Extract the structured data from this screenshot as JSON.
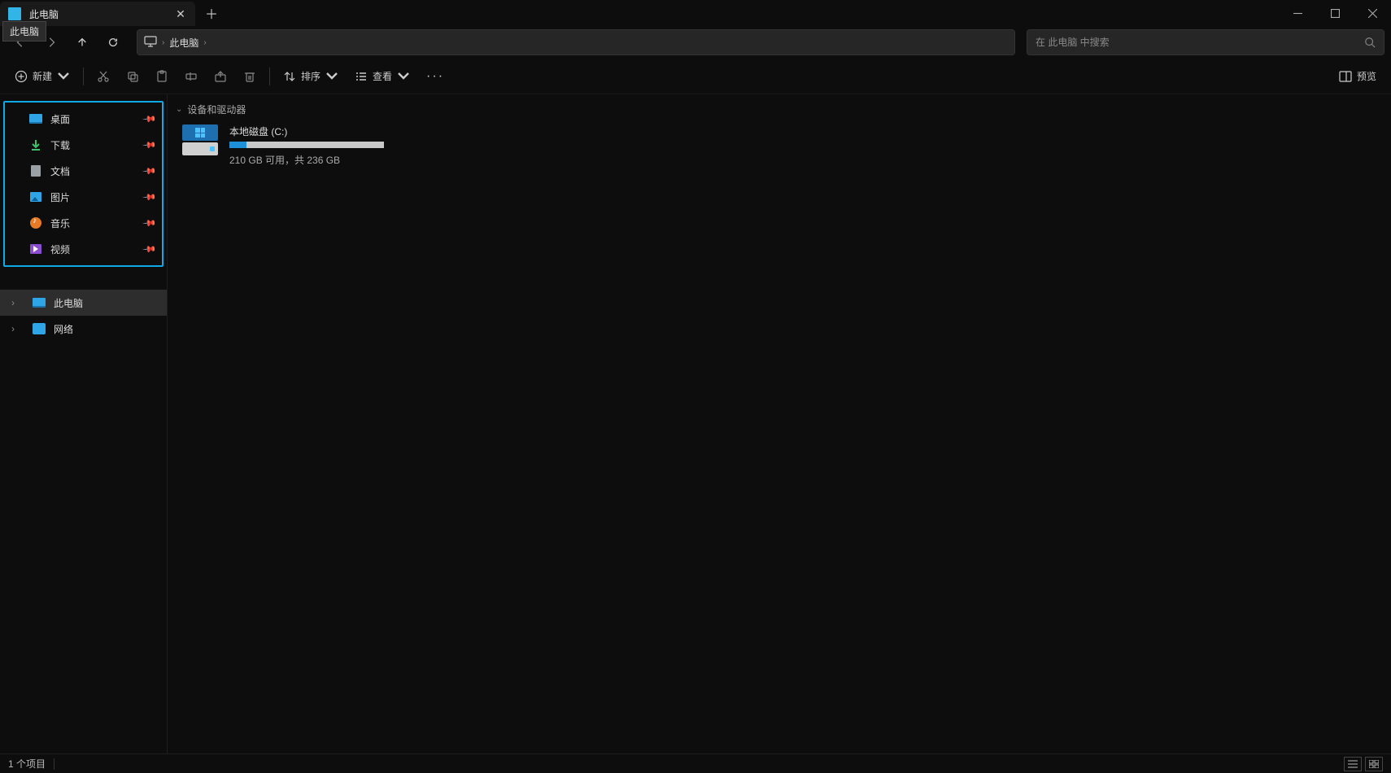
{
  "tab": {
    "title": "此电脑"
  },
  "tooltip": "此电脑",
  "breadcrumb": {
    "location": "此电脑"
  },
  "search": {
    "placeholder": "在 此电脑 中搜索"
  },
  "toolbar": {
    "new_label": "新建",
    "sort_label": "排序",
    "view_label": "查看",
    "preview_label": "预览"
  },
  "sidebar": {
    "quick": [
      {
        "label": "桌面"
      },
      {
        "label": "下载"
      },
      {
        "label": "文档"
      },
      {
        "label": "图片"
      },
      {
        "label": "音乐"
      },
      {
        "label": "视频"
      }
    ],
    "tree": [
      {
        "label": "此电脑",
        "selected": true
      },
      {
        "label": "网络",
        "selected": false
      }
    ]
  },
  "content": {
    "group_header": "设备和驱动器",
    "drive": {
      "name": "本地磁盘 (C:)",
      "capacity": "210 GB 可用，共 236 GB"
    }
  },
  "statusbar": {
    "count": "1 个项目"
  }
}
